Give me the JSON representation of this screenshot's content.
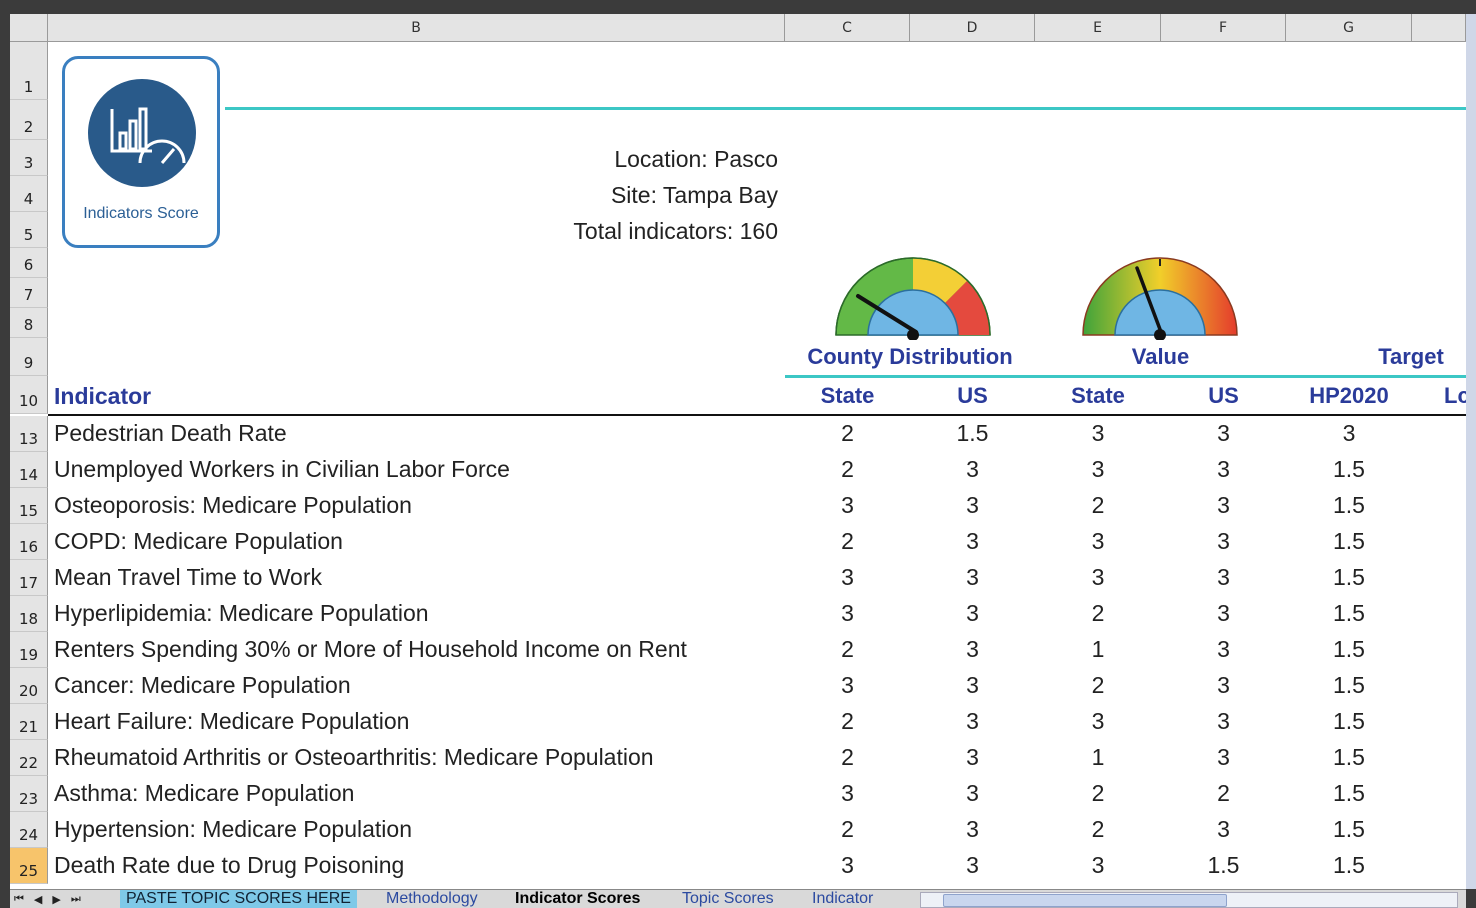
{
  "columns": [
    "B",
    "C",
    "D",
    "E",
    "F",
    "G"
  ],
  "header_rows": [
    "1",
    "2",
    "3",
    "4",
    "5",
    "6",
    "7",
    "8",
    "9",
    "10"
  ],
  "logo": {
    "label": "Indicators Score",
    "icon": "chart-gauge-icon"
  },
  "info": {
    "location": "Location: Pasco",
    "site": "Site: Tampa Bay",
    "total": "Total indicators: 160"
  },
  "groups": {
    "county": "County Distribution",
    "value": "Value",
    "target": "Target"
  },
  "table": {
    "indicator_header": "Indicator",
    "subheaders": [
      "State",
      "US",
      "State",
      "US",
      "HP2020",
      "Lc"
    ],
    "rows": [
      {
        "row": "13",
        "name": "Pedestrian Death Rate",
        "v": [
          "2",
          "1.5",
          "3",
          "3",
          "3"
        ]
      },
      {
        "row": "14",
        "name": "Unemployed Workers in Civilian Labor Force",
        "v": [
          "2",
          "3",
          "3",
          "3",
          "1.5"
        ]
      },
      {
        "row": "15",
        "name": "Osteoporosis: Medicare Population",
        "v": [
          "3",
          "3",
          "2",
          "3",
          "1.5"
        ]
      },
      {
        "row": "16",
        "name": "COPD: Medicare Population",
        "v": [
          "2",
          "3",
          "3",
          "3",
          "1.5"
        ]
      },
      {
        "row": "17",
        "name": "Mean Travel Time to Work",
        "v": [
          "3",
          "3",
          "3",
          "3",
          "1.5"
        ]
      },
      {
        "row": "18",
        "name": "Hyperlipidemia: Medicare Population",
        "v": [
          "3",
          "3",
          "2",
          "3",
          "1.5"
        ]
      },
      {
        "row": "19",
        "name": "Renters Spending 30% or More of Household Income on Rent",
        "v": [
          "2",
          "3",
          "1",
          "3",
          "1.5"
        ]
      },
      {
        "row": "20",
        "name": "Cancer: Medicare Population",
        "v": [
          "3",
          "3",
          "2",
          "3",
          "1.5"
        ]
      },
      {
        "row": "21",
        "name": "Heart Failure: Medicare Population",
        "v": [
          "2",
          "3",
          "3",
          "3",
          "1.5"
        ]
      },
      {
        "row": "22",
        "name": "Rheumatoid Arthritis or Osteoarthritis: Medicare Population",
        "v": [
          "2",
          "3",
          "1",
          "3",
          "1.5"
        ]
      },
      {
        "row": "23",
        "name": "Asthma: Medicare Population",
        "v": [
          "3",
          "3",
          "2",
          "2",
          "1.5"
        ]
      },
      {
        "row": "24",
        "name": "Hypertension: Medicare Population",
        "v": [
          "2",
          "3",
          "2",
          "3",
          "1.5"
        ]
      },
      {
        "row": "25",
        "name": "Death Rate due to Drug Poisoning",
        "v": [
          "3",
          "3",
          "3",
          "1.5",
          "1.5"
        ]
      }
    ]
  },
  "tabs": [
    "PASTE TOPIC SCORES HERE",
    "Methodology",
    "Indicator Scores",
    "Topic Scores",
    "Indicator"
  ],
  "active_tab": "Indicator Scores",
  "selected_row": "25",
  "colors": {
    "accent": "#3cc7c5",
    "header_text": "#2a3b9a",
    "logo_blue": "#295a8a"
  }
}
